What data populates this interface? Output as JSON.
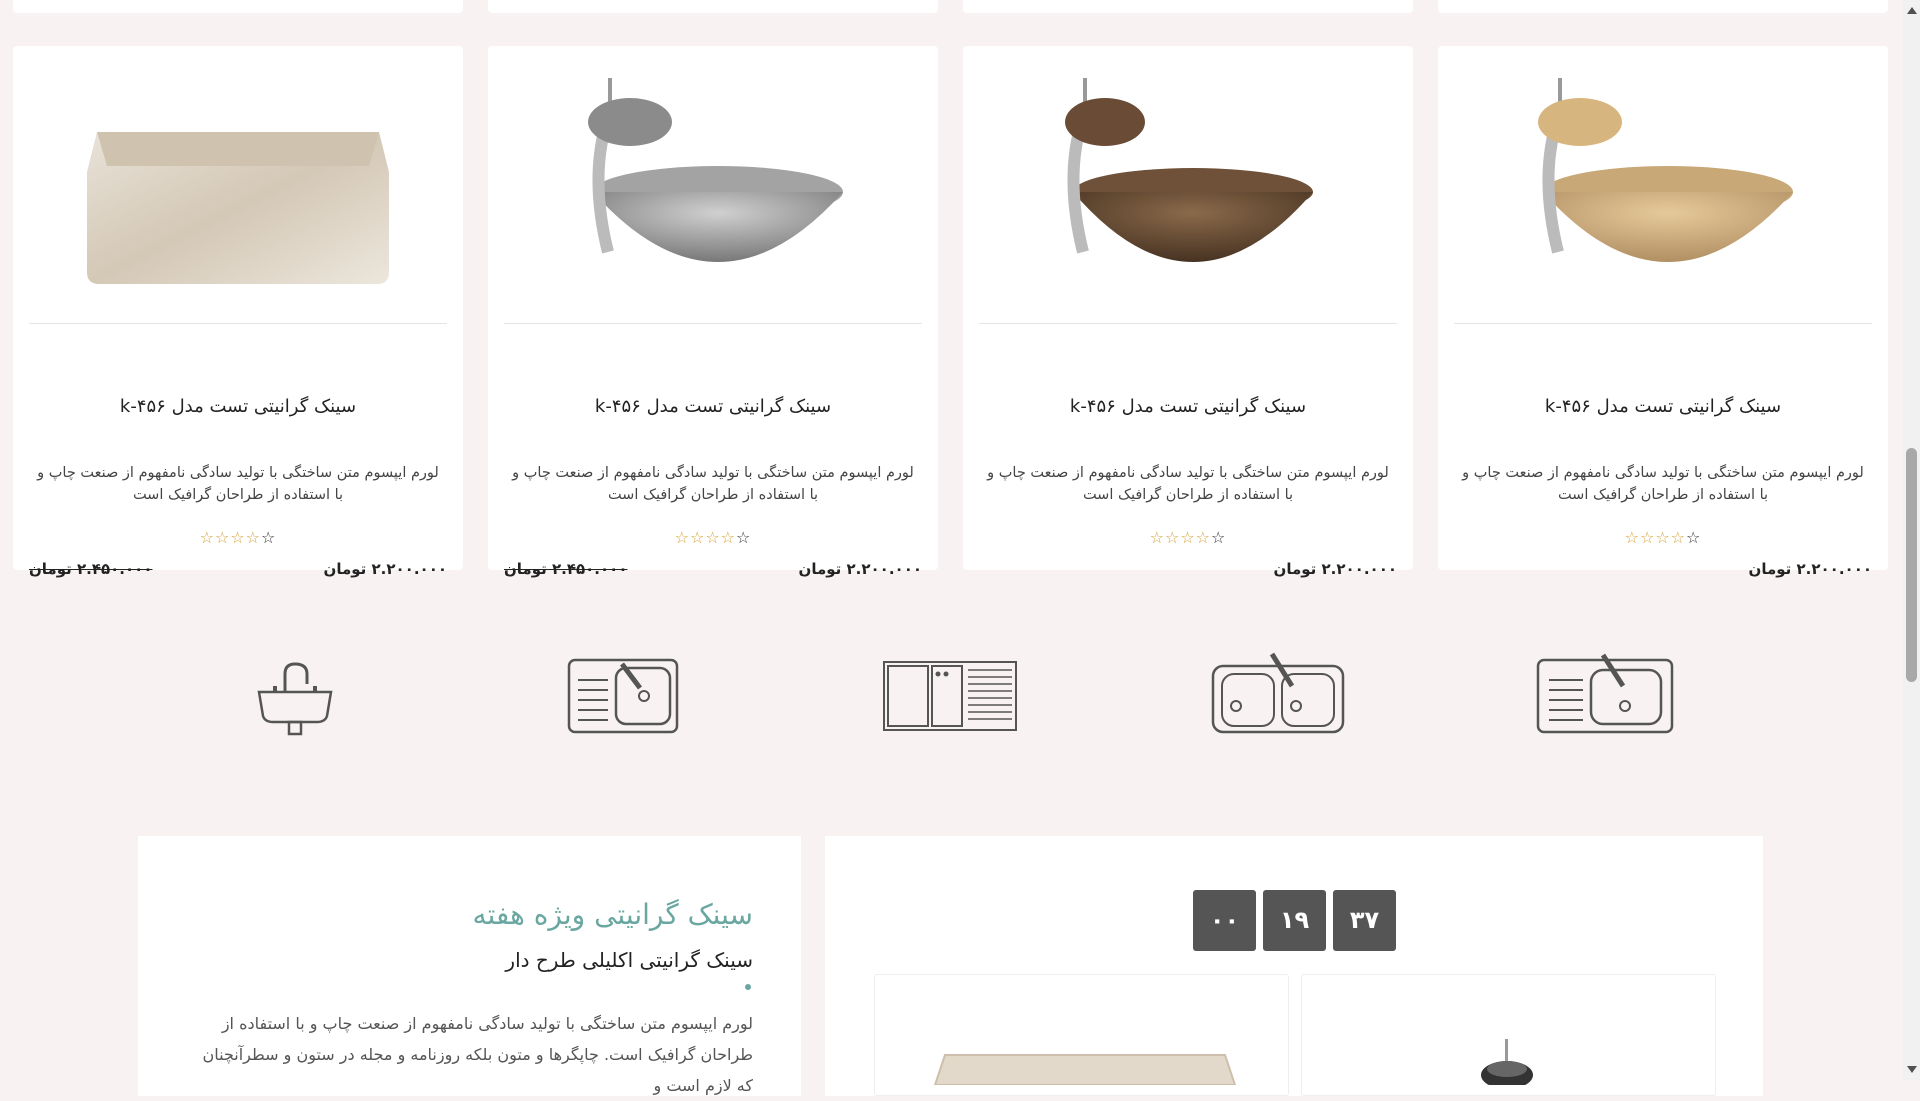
{
  "products": [
    {
      "title": "سینک گرانیتی تست مدل k-۴۵۶",
      "desc": "لورم ایپسوم متن ساختگی با تولید سادگی نامفهوم از صنعت چاپ و با استفاده از طراحان گرافیک است",
      "price": "۲.۲۰۰.۰۰۰ تومان",
      "old_price": "",
      "rating": "0 of 5",
      "image": "beige-vessel-sink-with-faucet"
    },
    {
      "title": "سینک گرانیتی تست مدل k-۴۵۶",
      "desc": "لورم ایپسوم متن ساختگی با تولید سادگی نامفهوم از صنعت چاپ و با استفاده از طراحان گرافیک است",
      "price": "۲.۲۰۰.۰۰۰ تومان",
      "old_price": "",
      "rating": "0 of 5",
      "image": "brown-vessel-sink-with-faucet"
    },
    {
      "title": "سینک گرانیتی تست مدل k-۴۵۶",
      "desc": "لورم ایپسوم متن ساختگی با تولید سادگی نامفهوم از صنعت چاپ و با استفاده از طراحان گرافیک است",
      "price": "۲.۲۰۰.۰۰۰ تومان",
      "old_price": "۲.۴۵۰.۰۰۰ تومان",
      "rating": "0 of 5",
      "image": "grey-vessel-sink-with-faucet"
    },
    {
      "title": "سینک گرانیتی تست مدل k-۴۵۶",
      "desc": "لورم ایپسوم متن ساختگی با تولید سادگی نامفهوم از صنعت چاپ و با استفاده از طراحان گرافیک است",
      "price": "۲.۲۰۰.۰۰۰ تومان",
      "old_price": "۲.۴۵۰.۰۰۰ تومان",
      "rating": "0 of 5",
      "image": "rectangular-travertine-sink"
    }
  ],
  "features": [
    {
      "icon": "double-bowl-sink-drainboard-icon"
    },
    {
      "icon": "double-bowl-sink-icon"
    },
    {
      "icon": "sink-with-drainboard-icon"
    },
    {
      "icon": "single-bowl-sink-drainboard-icon"
    },
    {
      "icon": "pedestal-sink-faucet-icon"
    }
  ],
  "special": {
    "title": "سینک گرانیتی ویژه هفته",
    "subtitle": "سینک گرانیتی اکلیلی طرح دار",
    "description": "لورم ایپسوم متن ساختگی با تولید سادگی نامفهوم از صنعت چاپ و با استفاده از طراحان گرافیک است. چاپگرها و متون بلکه روزنامه و مجله در ستون و سطرآنچنان که لازم است و"
  },
  "countdown": [
    "۳۷",
    "۱۹",
    "۰۰"
  ],
  "colors": {
    "accent": "#6aa7a1",
    "page_bg": "#f8f3f2",
    "countdown_bg": "#555555",
    "star": "#d6a33a"
  }
}
